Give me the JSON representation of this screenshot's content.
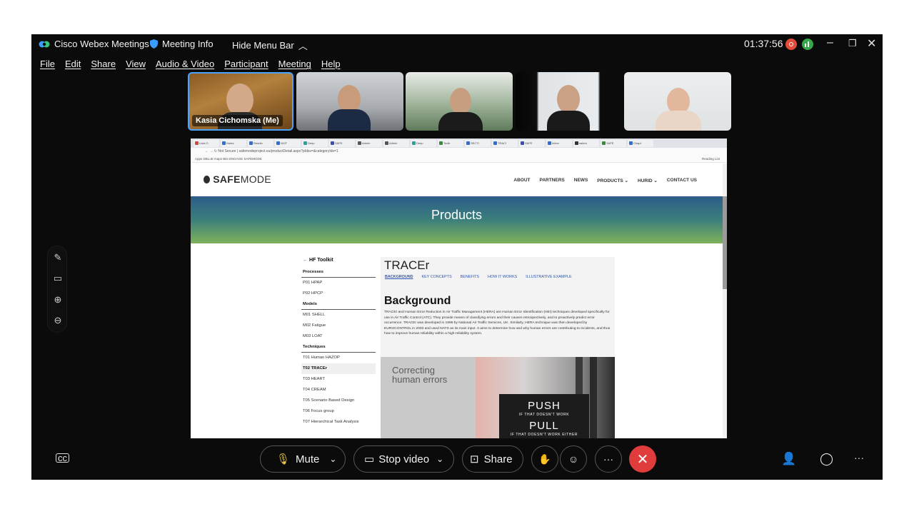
{
  "app": {
    "title": "Cisco Webex Meetings",
    "meeting_info": "Meeting Info",
    "hide_menu": "Hide Menu Bar",
    "clock": "01:37:56",
    "colors": {
      "accent": "#4aa3ff",
      "end_call": "#e03c3c",
      "record": "#e34b3a",
      "network": "#37a84a"
    }
  },
  "menu": [
    "File",
    "Edit",
    "Share",
    "View",
    "Audio & Video",
    "Participant",
    "Meeting",
    "Help"
  ],
  "participants": [
    {
      "name": "Kasia Cichomska (Me)"
    }
  ],
  "side_tools": [
    "annotate-icon",
    "share-screen-icon",
    "zoom-in-icon",
    "zoom-out-icon"
  ],
  "browser": {
    "tabs": [
      "Lista O",
      "Notes",
      "Readin",
      "WUT",
      "Deep",
      "SAFE",
      "Admin",
      "Admin",
      "Deep",
      "Toolk",
      "SECTI",
      "TRACI",
      "SAFE",
      "Interv",
      "safem",
      "SAFE",
      "Chapt"
    ],
    "address": "Not Secure | safemodeproject.eu/productDetail.aspx?pIdss=&categoryIds=1",
    "bookmarks": "Apps   DBLoE maps   Bits   ENGAGE   SAFEMODE",
    "reading_list": "Reading List"
  },
  "site": {
    "logo_bold": "SAFE",
    "logo_light": "MODE",
    "nav": [
      "ABOUT",
      "PARTNERS",
      "NEWS",
      "PRODUCTS ⌄",
      "HURID ⌄",
      "CONTACT US"
    ],
    "hero_title": "Products",
    "sidebar": {
      "back": "HF Toolkit",
      "rows": [
        {
          "label": "Processes",
          "type": "head"
        },
        {
          "label": "P01 HPAP",
          "type": "item"
        },
        {
          "label": "P02 HPCP",
          "type": "item"
        },
        {
          "label": "Models",
          "type": "head"
        },
        {
          "label": "M01 SHELL",
          "type": "item"
        },
        {
          "label": "M02 Fatigue",
          "type": "item"
        },
        {
          "label": "M03 LOAT",
          "type": "item"
        },
        {
          "label": "Techniques",
          "type": "head"
        },
        {
          "label": "T01 Human HAZOP",
          "type": "item"
        },
        {
          "label": "T02 TRACEr",
          "type": "active"
        },
        {
          "label": "T03 HEART",
          "type": "item"
        },
        {
          "label": "T04 CREAM",
          "type": "item"
        },
        {
          "label": "T05 Scenario Based Design",
          "type": "item"
        },
        {
          "label": "T06 Focus group",
          "type": "item"
        },
        {
          "label": "T07 Hierarchical Task Analysis",
          "type": "item"
        }
      ]
    },
    "content": {
      "title": "TRACEr",
      "tabs": [
        "BACKGROUND",
        "KEY CONCEPTS",
        "BENEFITS",
        "HOW IT WORKS",
        "ILLUSTRATIVE EXAMPLE"
      ],
      "heading": "Background",
      "body": "TRACEr and Human Error Reduction in Air Traffic Management (HERA) are Human Error Identification (HEI) techniques developed specifically for use in Air Traffic Control (ATC). They provide means of classifying errors and their causes retrospectively, and to proactively predict error occurrence. TRACEr was developed in 1999 by National Air Traffic Services, UK. Similarly, HERA technique was then developed by EUROCONTROL in 2003 and used NATS as its main input. It aims to determine how and why human errors are contributing to incidents, and thus how to improve human reliability within a high-reliability system.",
      "image": {
        "caption_1": "Correcting",
        "caption_2": "human errors",
        "push": "PUSH",
        "push_sub": "IF THAT DOESN'T WORK",
        "pull": "PULL",
        "pull_sub": "IF THAT DOESN'T WORK EITHER"
      }
    }
  },
  "controls": {
    "mute": "Mute",
    "stop_video": "Stop video",
    "share": "Share"
  }
}
